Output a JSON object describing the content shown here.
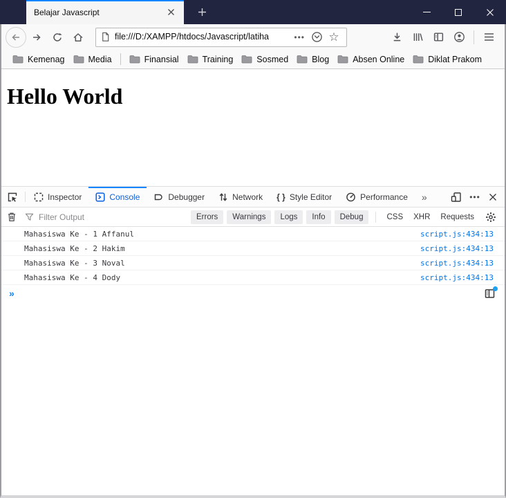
{
  "titlebar": {
    "tab_title": "Belajar Javascript"
  },
  "navbar": {
    "url": "file:///D:/XAMPP/htdocs/Javascript/latiha"
  },
  "bookmarks": {
    "items": [
      "Kemenag",
      "Media",
      "Finansial",
      "Training",
      "Sosmed",
      "Blog",
      "Absen Online",
      "Diklat Prakom"
    ]
  },
  "page": {
    "heading": "Hello World"
  },
  "devtools": {
    "tabs": [
      "Inspector",
      "Console",
      "Debugger",
      "Network",
      "Style Editor",
      "Performance"
    ],
    "active_tab": "Console",
    "filter": {
      "placeholder": "Filter Output",
      "levels": [
        "Errors",
        "Warnings",
        "Logs",
        "Info",
        "Debug"
      ],
      "types": [
        "CSS",
        "XHR",
        "Requests"
      ]
    },
    "console": {
      "messages": [
        {
          "text": "Mahasiswa Ke - 1 Affanul",
          "source": "script.js:434:13"
        },
        {
          "text": "Mahasiswa Ke - 2 Hakim",
          "source": "script.js:434:13"
        },
        {
          "text": "Mahasiswa Ke - 3 Noval",
          "source": "script.js:434:13"
        },
        {
          "text": "Mahasiswa Ke - 4 Dody",
          "source": "script.js:434:13"
        }
      ]
    }
  },
  "icons": {
    "page_actions": "•••",
    "overflow_menu": "•••",
    "more_tabs": "»",
    "prompt": "»",
    "brace_glyph": "{ }",
    "star": "☆"
  },
  "colors": {
    "titlebar": "#212540",
    "accent": "#0a84ff",
    "devtools_active": "#0a60df",
    "link": "#0074e8",
    "toolbar_bg": "#f9f9fa",
    "button_bg": "#ededf0",
    "notification_dot": "#1ba2f3"
  }
}
